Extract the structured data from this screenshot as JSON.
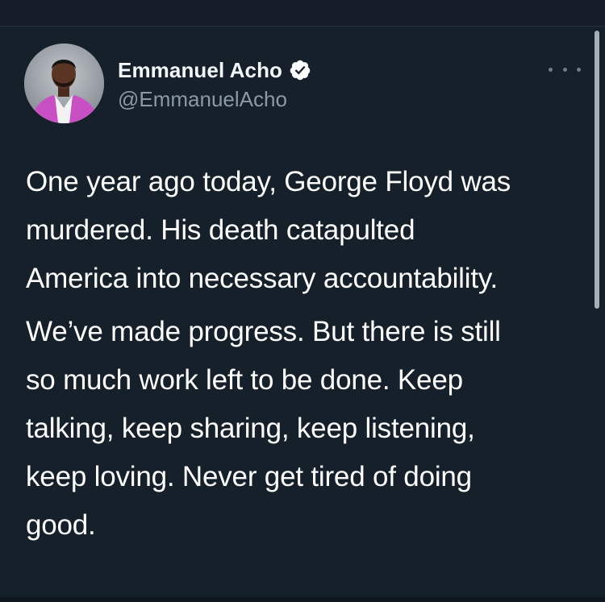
{
  "tweet": {
    "author": {
      "display_name": "Emmanuel Acho",
      "handle": "@EmmanuelAcho",
      "verified": true
    },
    "paragraphs": [
      {
        "lines": [
          "One year ago today, George Floyd was",
          "murdered. His death catapulted",
          "America into necessary accountability."
        ]
      },
      {
        "lines": [
          "We’ve made progress. But there is still",
          "so much work left to be done. Keep",
          "talking, keep sharing, keep listening,",
          "keep loving. Never get tired of doing",
          "good."
        ]
      }
    ]
  },
  "icons": {
    "verified": "verified-badge-icon",
    "more": "more-options-icon"
  },
  "colors": {
    "background": "#15202b",
    "text": "#ffffff",
    "handle": "#8b98a5",
    "jacket": "#c94fc4"
  }
}
